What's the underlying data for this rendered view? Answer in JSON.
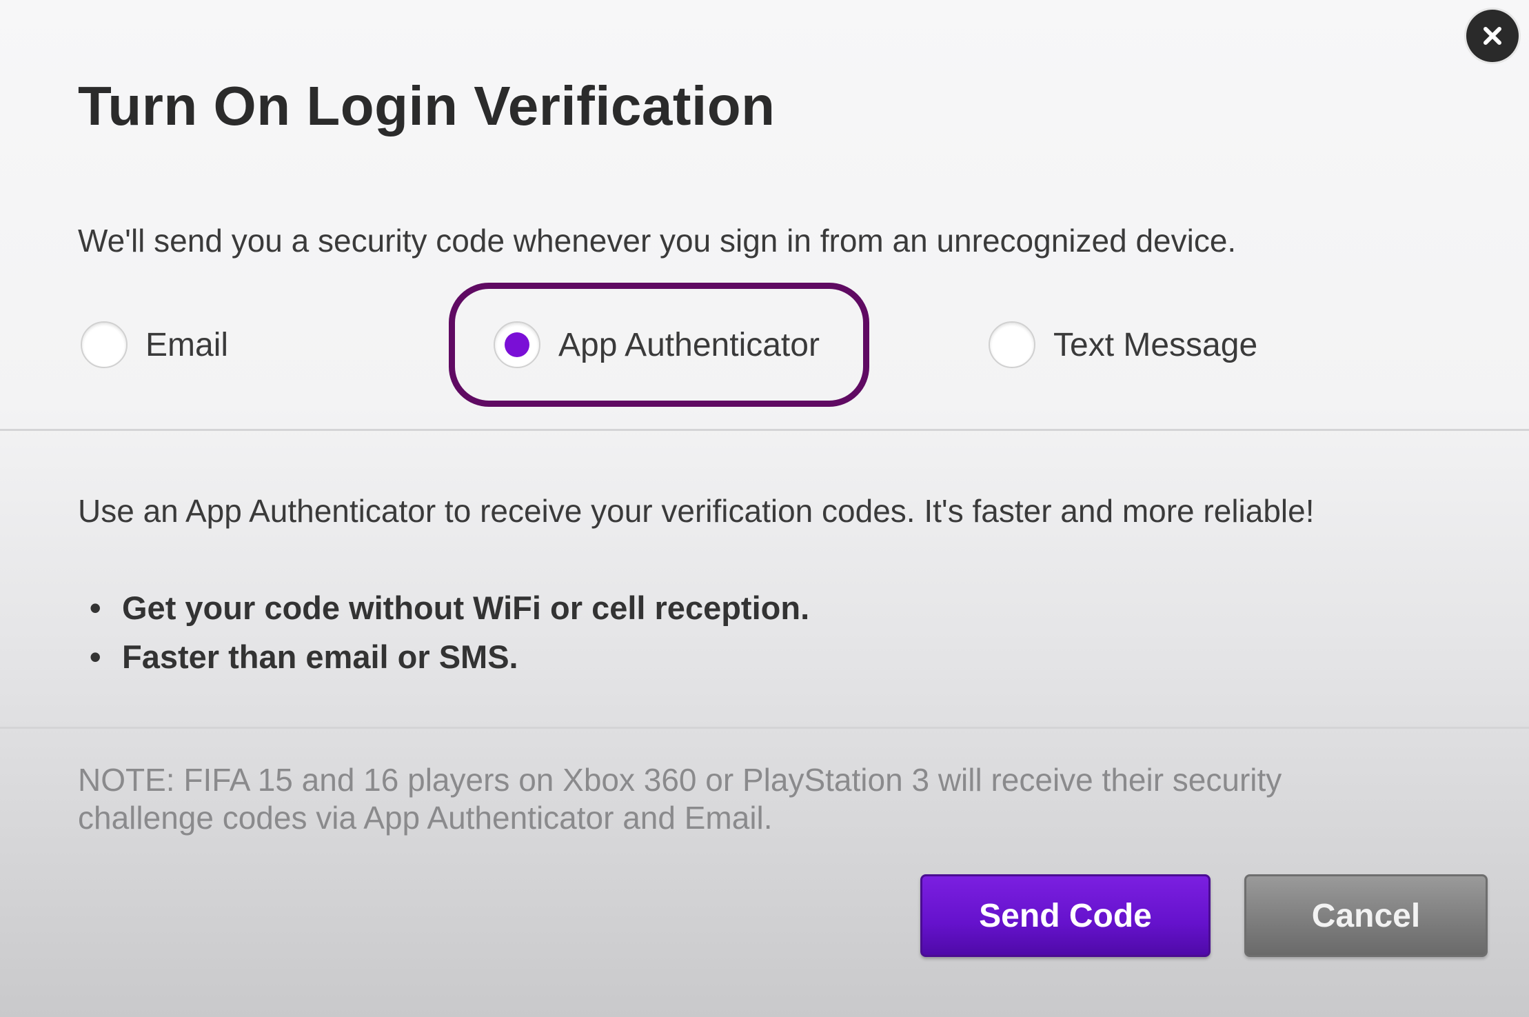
{
  "dialog": {
    "title": "Turn On Login Verification",
    "intro": "We'll send you a security code whenever you sign in from an unrecognized device.",
    "close_icon": "close-icon",
    "options": [
      {
        "label": "Email",
        "selected": false
      },
      {
        "label": "App Authenticator",
        "selected": true
      },
      {
        "label": "Text Message",
        "selected": false
      }
    ],
    "description": "Use an App Authenticator to receive your verification codes. It's faster and more reliable!",
    "bullets": [
      "Get your code without WiFi or cell reception.",
      "Faster than email or SMS."
    ],
    "note": "NOTE: FIFA 15 and 16 players on Xbox 360 or PlayStation 3 will receive their security challenge codes via App Authenticator and Email.",
    "buttons": {
      "send_label": "Send Code",
      "cancel_label": "Cancel"
    },
    "colors": {
      "accent": "#7a0fd6",
      "highlight_outline": "#5f0a62",
      "send_button": "#6512cc",
      "cancel_button": "#7c7c7c"
    }
  }
}
